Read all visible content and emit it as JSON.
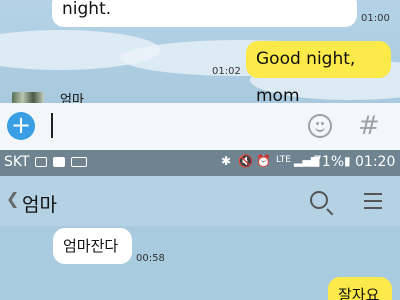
{
  "top_chat": {
    "msg_in_partial": "night.",
    "time_in": "01:00",
    "msg_out": "Good night, mom",
    "time_out": "01:02",
    "sender_partial": "엄마"
  },
  "input": {
    "icons": [
      "plus-icon",
      "emoji-icon",
      "hash-icon"
    ]
  },
  "status_bar": {
    "carrier": "SKT",
    "lte": "LTE",
    "battery": "71%",
    "time": "01:20"
  },
  "chat": {
    "title": "엄마",
    "messages": [
      {
        "text": "엄마잔다",
        "time": "00:58",
        "type": "in"
      },
      {
        "text": "잘자요",
        "type": "out"
      }
    ]
  },
  "colors": {
    "accent": "#3a9ee4",
    "out_bubble": "#fce94a",
    "status_bar": "#6f8390"
  }
}
